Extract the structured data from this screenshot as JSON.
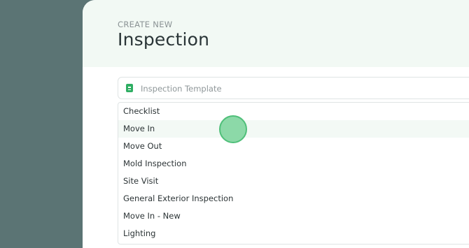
{
  "form": {
    "eyebrow": "CREATE NEW",
    "title": "Inspection"
  },
  "template_select": {
    "icon": "template-document-icon",
    "placeholder": "Inspection Template",
    "hovered_option": "Move In",
    "options": [
      "Checklist",
      "Move In",
      "Move Out",
      "Mold Inspection",
      "Site Visit",
      "General Exterior Inspection",
      "Move In - New",
      "Lighting"
    ]
  },
  "colors": {
    "backdrop": "#5b7474",
    "header_tint": "#f2f9f4",
    "accent": "#2fae63",
    "cursor_fill": "#8cd9a8"
  }
}
